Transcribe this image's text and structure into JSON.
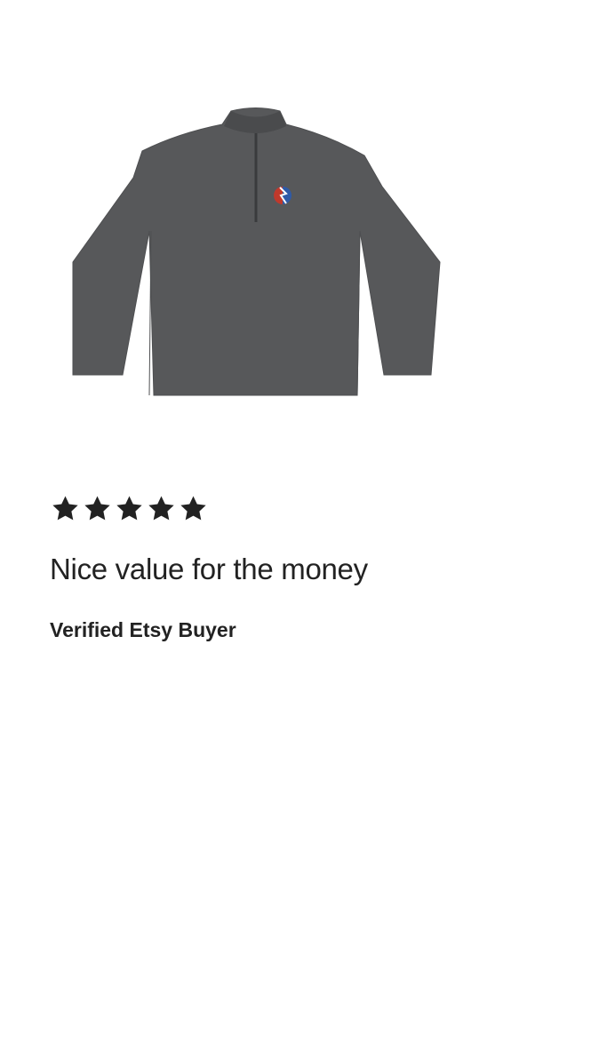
{
  "review": {
    "rating": 5,
    "rating_max": 5,
    "title": "Nice value for the money",
    "reviewer": "Verified Etsy Buyer"
  },
  "product": {
    "image_icon": "quarter-zip-pullover-image",
    "shirt_color": "#57585a",
    "logo_colors": [
      "#c0392b",
      "#ffffff",
      "#2e5aa8"
    ]
  },
  "colors": {
    "star": "#222222",
    "text": "#222222",
    "background": "#ffffff"
  }
}
